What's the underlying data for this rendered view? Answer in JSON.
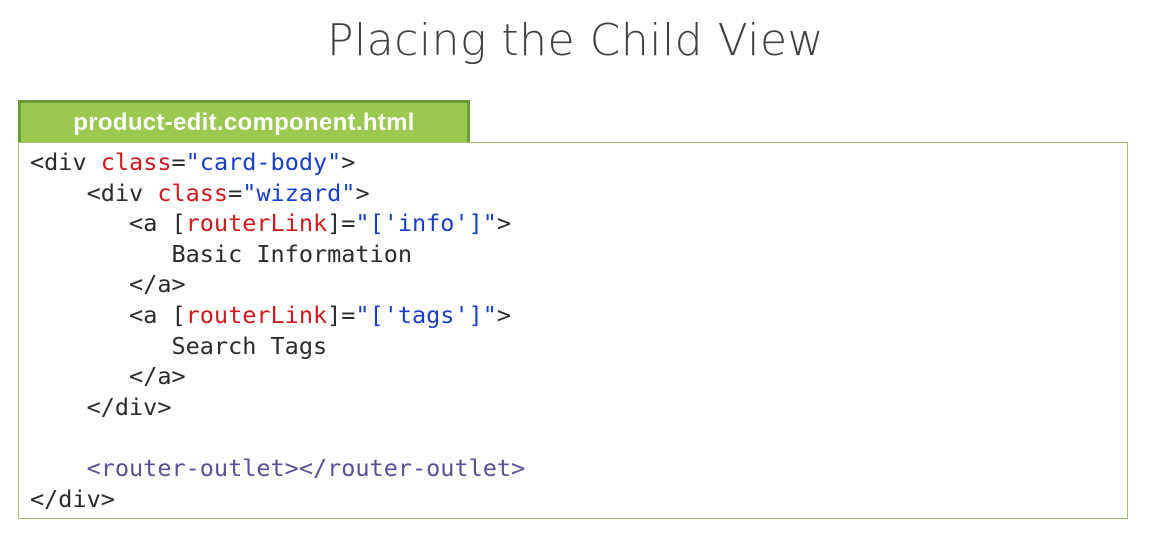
{
  "slide": {
    "title": "Placing the Child View"
  },
  "file_tab": {
    "label": "product-edit.component.html"
  },
  "colors": {
    "tab_fill": "#9bc84e",
    "tab_border": "#6a9a3a",
    "code_border": "#a6c070",
    "plain_text": "#2b2b2b",
    "attribute": "#d0181e",
    "string": "#1b3ec8",
    "element_tag": "#5b4f97"
  },
  "code": {
    "lines": [
      {
        "indent": "",
        "tokens": [
          {
            "t": "text",
            "v": "<div "
          },
          {
            "t": "attr",
            "v": "class"
          },
          {
            "t": "text",
            "v": "="
          },
          {
            "t": "str",
            "v": "\"card-body\""
          },
          {
            "t": "text",
            "v": ">"
          }
        ]
      },
      {
        "indent": "    ",
        "tokens": [
          {
            "t": "text",
            "v": "<div "
          },
          {
            "t": "attr",
            "v": "class"
          },
          {
            "t": "text",
            "v": "="
          },
          {
            "t": "str",
            "v": "\"wizard\""
          },
          {
            "t": "text",
            "v": ">"
          }
        ]
      },
      {
        "indent": "       ",
        "tokens": [
          {
            "t": "text",
            "v": "<a ["
          },
          {
            "t": "attr",
            "v": "routerLink"
          },
          {
            "t": "text",
            "v": "]="
          },
          {
            "t": "str",
            "v": "\"['info']\""
          },
          {
            "t": "text",
            "v": ">"
          }
        ]
      },
      {
        "indent": "          ",
        "tokens": [
          {
            "t": "text",
            "v": "Basic Information"
          }
        ]
      },
      {
        "indent": "       ",
        "tokens": [
          {
            "t": "text",
            "v": "</a>"
          }
        ]
      },
      {
        "indent": "       ",
        "tokens": [
          {
            "t": "text",
            "v": "<a ["
          },
          {
            "t": "attr",
            "v": "routerLink"
          },
          {
            "t": "text",
            "v": "]="
          },
          {
            "t": "str",
            "v": "\"['tags']\""
          },
          {
            "t": "text",
            "v": ">"
          }
        ]
      },
      {
        "indent": "          ",
        "tokens": [
          {
            "t": "text",
            "v": "Search Tags"
          }
        ]
      },
      {
        "indent": "       ",
        "tokens": [
          {
            "t": "text",
            "v": "</a>"
          }
        ]
      },
      {
        "indent": "    ",
        "tokens": [
          {
            "t": "text",
            "v": "</div>"
          }
        ]
      },
      {
        "indent": "",
        "tokens": []
      },
      {
        "indent": "    ",
        "tokens": [
          {
            "t": "elem",
            "v": "<router-outlet></router-outlet>"
          }
        ]
      },
      {
        "indent": "",
        "tokens": [
          {
            "t": "text",
            "v": "</div>"
          }
        ]
      }
    ]
  }
}
